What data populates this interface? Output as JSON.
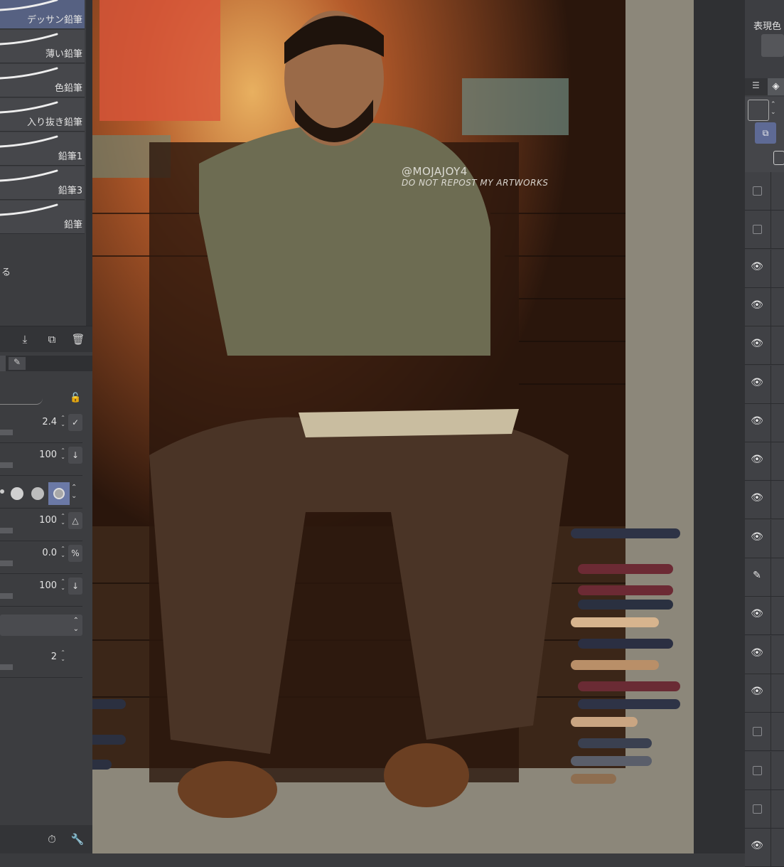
{
  "brushes": [
    {
      "label": "デッサン鉛筆",
      "selected": true
    },
    {
      "label": "薄い鉛筆",
      "selected": false
    },
    {
      "label": "色鉛筆",
      "selected": false
    },
    {
      "label": "入り抜き鉛筆",
      "selected": false
    },
    {
      "label": "鉛筆1",
      "selected": false
    },
    {
      "label": "鉛筆3",
      "selected": false
    },
    {
      "label": "鉛筆",
      "selected": false
    }
  ],
  "brush_panel": {
    "partial_text": "る",
    "buttons": [
      "download-icon",
      "duplicate-icon",
      "trash-icon"
    ]
  },
  "tool_props": {
    "rows": [
      {
        "value": "2.4",
        "button": "✓"
      },
      {
        "value": "100",
        "button": "↓"
      },
      {
        "value": "100",
        "button": "△"
      },
      {
        "value": "0.0",
        "button": "%"
      },
      {
        "value": "100",
        "button": "↓"
      },
      {
        "value": "2",
        "button": ""
      }
    ]
  },
  "right_panel": {
    "header_label": "表現色",
    "layers_visibility": [
      "hidden",
      "hidden",
      "visible",
      "visible",
      "visible",
      "visible",
      "visible",
      "visible",
      "visible",
      "visible",
      "edit",
      "visible",
      "visible",
      "visible",
      "hidden",
      "hidden",
      "hidden",
      "visible"
    ]
  },
  "canvas": {
    "watermark_line1": "@MOJAJOY4",
    "watermark_line2": "DO NOT REPOST MY ARTWORKS"
  },
  "colors": {
    "selected_brush": "#566182",
    "panel_bg": "#3c3d40",
    "canvas_bg": "#8c877a"
  }
}
